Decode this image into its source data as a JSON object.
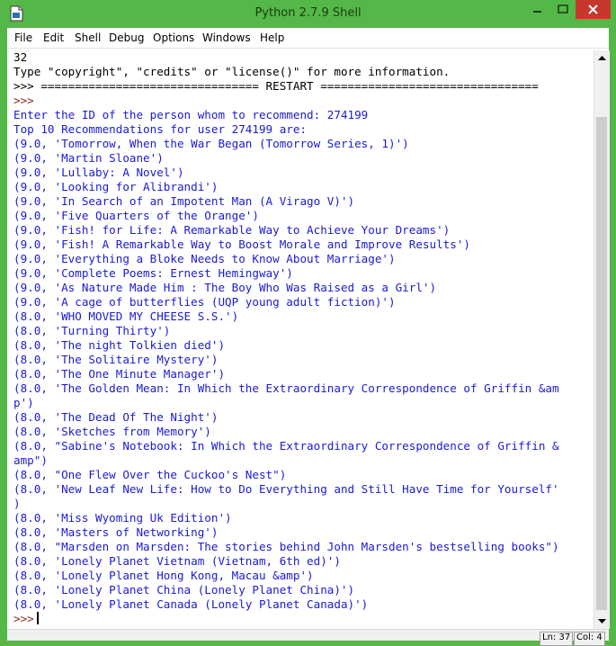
{
  "window": {
    "title": "Python 2.7.9 Shell"
  },
  "menu": {
    "items": [
      "File",
      "Edit",
      "Shell",
      "Debug",
      "Options",
      "Windows",
      "Help"
    ]
  },
  "shell": {
    "lines": [
      {
        "text": "32",
        "style": "std"
      },
      {
        "text": "Type \"copyright\", \"credits\" or \"license()\" for more information.",
        "style": "std"
      },
      {
        "text": ">>> ================================ RESTART ================================",
        "style": "std"
      },
      {
        "text": ">>>",
        "style": "prompt"
      },
      {
        "text": "Enter the ID of the person whom to recommend: 274199",
        "style": "out"
      },
      {
        "text": "Top 10 Recommendations for user 274199 are:",
        "style": "out"
      },
      {
        "text": "(9.0, 'Tomorrow, When the War Began (Tomorrow Series, 1)')",
        "style": "out"
      },
      {
        "text": "(9.0, 'Martin Sloane')",
        "style": "out"
      },
      {
        "text": "(9.0, 'Lullaby: A Novel')",
        "style": "out"
      },
      {
        "text": "(9.0, 'Looking for Alibrandi')",
        "style": "out"
      },
      {
        "text": "(9.0, 'In Search of an Impotent Man (A Virago V)')",
        "style": "out"
      },
      {
        "text": "(9.0, 'Five Quarters of the Orange')",
        "style": "out"
      },
      {
        "text": "(9.0, 'Fish! for Life: A Remarkable Way to Achieve Your Dreams')",
        "style": "out"
      },
      {
        "text": "(9.0, 'Fish! A Remarkable Way to Boost Morale and Improve Results')",
        "style": "out"
      },
      {
        "text": "(9.0, 'Everything a Bloke Needs to Know About Marriage')",
        "style": "out"
      },
      {
        "text": "(9.0, 'Complete Poems: Ernest Hemingway')",
        "style": "out"
      },
      {
        "text": "(9.0, 'As Nature Made Him : The Boy Who Was Raised as a Girl')",
        "style": "out"
      },
      {
        "text": "(9.0, 'A cage of butterflies (UQP young adult fiction)')",
        "style": "out"
      },
      {
        "text": "(8.0, 'WHO MOVED MY CHEESE S.S.')",
        "style": "out"
      },
      {
        "text": "(8.0, 'Turning Thirty')",
        "style": "out"
      },
      {
        "text": "(8.0, 'The night Tolkien died')",
        "style": "out"
      },
      {
        "text": "(8.0, 'The Solitaire Mystery')",
        "style": "out"
      },
      {
        "text": "(8.0, 'The One Minute Manager')",
        "style": "out"
      },
      {
        "text": "(8.0, 'The Golden Mean: In Which the Extraordinary Correspondence of Griffin &am",
        "style": "out"
      },
      {
        "text": "p')",
        "style": "out"
      },
      {
        "text": "(8.0, 'The Dead Of The Night')",
        "style": "out"
      },
      {
        "text": "(8.0, 'Sketches from Memory')",
        "style": "out"
      },
      {
        "text": "(8.0, \"Sabine's Notebook: In Which the Extraordinary Correspondence of Griffin &",
        "style": "out"
      },
      {
        "text": "amp\")",
        "style": "out"
      },
      {
        "text": "(8.0, \"One Flew Over the Cuckoo's Nest\")",
        "style": "out"
      },
      {
        "text": "(8.0, 'New Leaf New Life: How to Do Everything and Still Have Time for Yourself'",
        "style": "out"
      },
      {
        "text": ")",
        "style": "out"
      },
      {
        "text": "(8.0, 'Miss Wyoming Uk Edition')",
        "style": "out"
      },
      {
        "text": "(8.0, 'Masters of Networking')",
        "style": "out"
      },
      {
        "text": "(8.0, \"Marsden on Marsden: The stories behind John Marsden's bestselling books\")",
        "style": "out"
      },
      {
        "text": "(8.0, 'Lonely Planet Vietnam (Vietnam, 6th ed)')",
        "style": "out"
      },
      {
        "text": "(8.0, 'Lonely Planet Hong Kong, Macau &amp')",
        "style": "out"
      },
      {
        "text": "(8.0, 'Lonely Planet China (Lonely Planet China)')",
        "style": "out"
      },
      {
        "text": "(8.0, 'Lonely Planet Canada (Lonely Planet Canada)')",
        "style": "out"
      }
    ],
    "prompt": ">>>"
  },
  "status": {
    "line": "Ln: 37",
    "col": "Col: 4"
  },
  "colors": {
    "titlebar": "#54b848",
    "close_button": "#c7372e",
    "output_text": "#1a1ad6",
    "prompt_text": "#8b1f1f"
  }
}
